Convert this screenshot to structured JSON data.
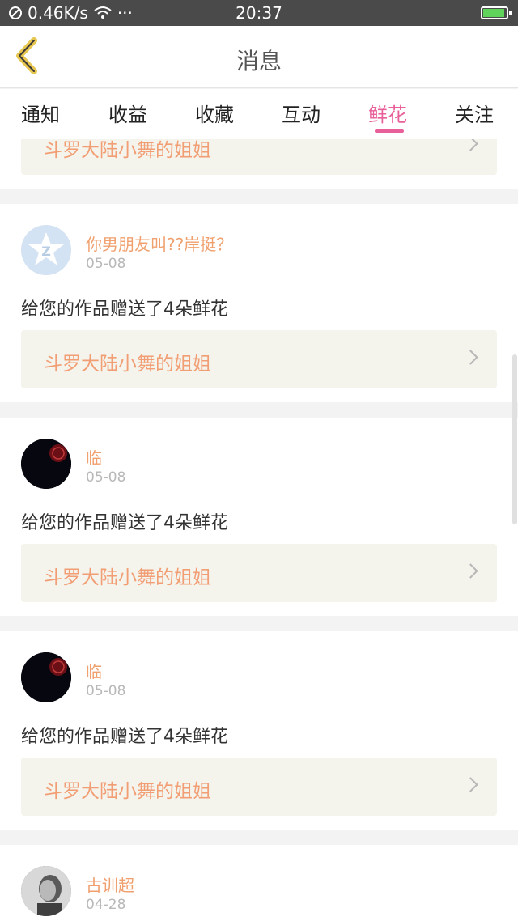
{
  "status_bar": {
    "network_speed": "0.46K/s",
    "more": "···",
    "time": "20:37"
  },
  "header": {
    "title": "消息"
  },
  "tabs": [
    {
      "label": "通知"
    },
    {
      "label": "收益"
    },
    {
      "label": "收藏"
    },
    {
      "label": "互动"
    },
    {
      "label": "鲜花"
    },
    {
      "label": "关注"
    }
  ],
  "active_tab": "鲜花",
  "colors": {
    "accent": "#e8609a",
    "name_orange": "#f0a06e",
    "work_orange": "#f29e74",
    "status_bar_bg": "#4a4a4a"
  },
  "partial_item": {
    "work_title": "斗罗大陆小舞的姐姐"
  },
  "items": [
    {
      "user": "你男朋友叫??岸挺？",
      "date": "05-08",
      "message": "给您的作品赠送了4朵鲜花",
      "work_title": "斗罗大陆小舞的姐姐",
      "avatar": "qzone-default-avatar"
    },
    {
      "user": "临",
      "date": "05-08",
      "message": "给您的作品赠送了4朵鲜花",
      "work_title": "斗罗大陆小舞的姐姐",
      "avatar": "dark-seal-avatar"
    },
    {
      "user": "临",
      "date": "05-08",
      "message": "给您的作品赠送了4朵鲜花",
      "work_title": "斗罗大陆小舞的姐姐",
      "avatar": "dark-seal-avatar"
    },
    {
      "user": "古训超",
      "date": "04-28",
      "avatar": "photo-avatar"
    }
  ]
}
